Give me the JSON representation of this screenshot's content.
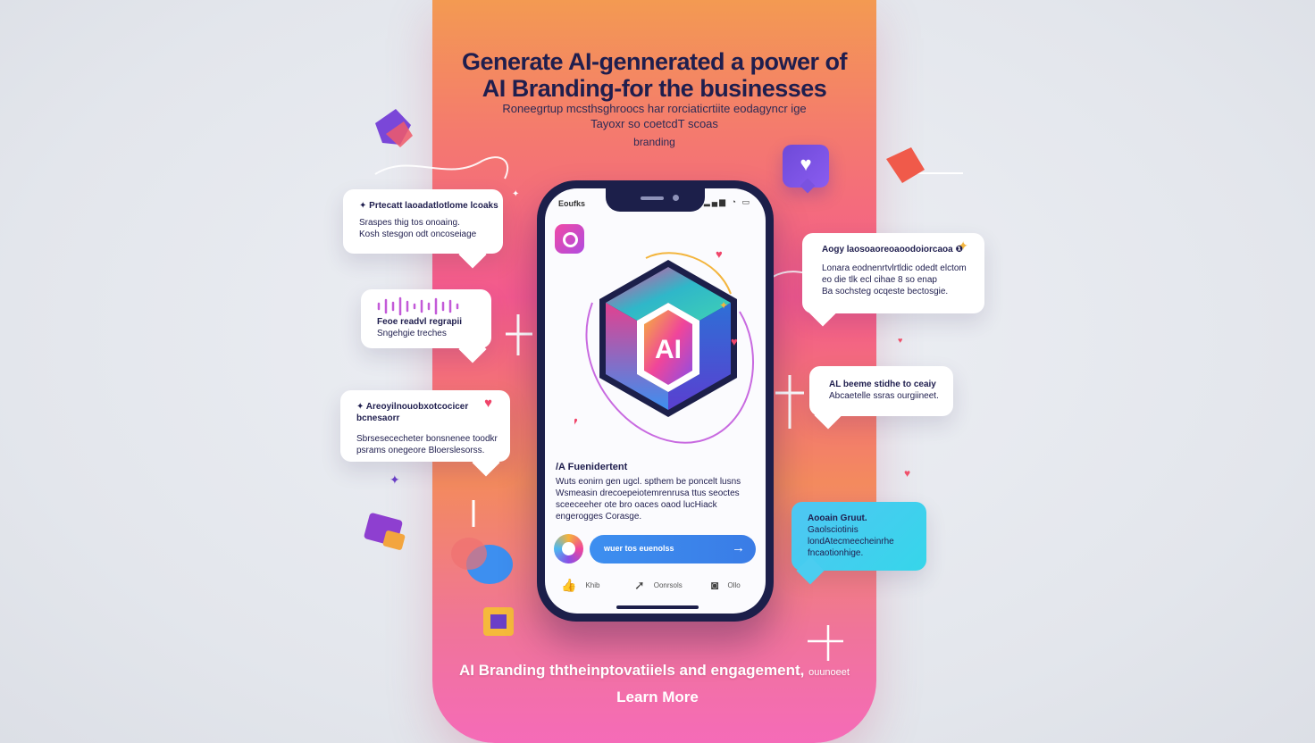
{
  "hero": {
    "headline_line1": "Generate AI-gennerated  a power of",
    "headline_line2": "AI  Branding-for the businesses",
    "sub_line1": "Roneegrtup mcsthsghroocs har rorciaticrtiite eodagyncr ige",
    "sub_line2": "Tayoxr so coetcdT scoas",
    "sub_line3": "branding"
  },
  "phone": {
    "status_label": "Eoufks",
    "status_icons": "▂▄▆ ◔ ▭",
    "logo_text": "AI",
    "section_title": "/A Fuenidertent",
    "section_body": "Wuts eonirn gen ugcl. spthem be poncelt lusns Wsmeasin drecoepeiotemrenrusa ttus seoctes sceeceeher ote bro oaces oaod lucHiack engerogges Corasge.",
    "cta_label": "wuer tos euenolss",
    "cta_arrow": "→",
    "actions": [
      {
        "icon": "thumbs-up",
        "glyph": "👍",
        "label": "Khib"
      },
      {
        "icon": "share",
        "glyph": "➚",
        "label": "Oonrsols"
      },
      {
        "icon": "save",
        "glyph": "◙",
        "label": "Ollo"
      }
    ]
  },
  "bubbles": {
    "left_top": {
      "line1": "✦ Prtecatt laoadatlotlome lcoaks",
      "line2": "Sraspes thig tos onoaing.",
      "line3": "Kosh stesgon odt oncoseiage"
    },
    "left_mid": {
      "line1": "Feoe readvl regrapii",
      "line2": "Sngehgie treches"
    },
    "left_bottom": {
      "line1": "✦ Areoyilnouobxotcocicer bcnesaorr",
      "line2": "Sbrsesececheter bonsnenee toodkr",
      "line3": "psrams onegeore Bloerslesorss."
    },
    "right_top": {
      "line1": "Aogy laosoaoreoaoodoiorcaoa ❶",
      "line2": "Lonara eodnenrtvlrtldic odedt elctom",
      "line3": "eo die tlk ecl cihae 8 so enap",
      "line4": "Ba sochsteg ocqeste bectosgie."
    },
    "right_mid": {
      "line1": "AL beeme stidhe to ceaiy",
      "line2": "Abcaetelle ssras ourgiineet."
    },
    "right_bottom": {
      "line1": "Aooain Gruut.",
      "line2": "Gaolsciotinis",
      "line3": "londAtecmeecheinrhe",
      "line4": "fncaotionhige."
    }
  },
  "footer": {
    "tagline": "AI Branding ththeinptovatiiels and engagement,",
    "tagline_small": "ouunoeet",
    "learn_more": "Learn More"
  },
  "colors": {
    "panel_top": "#f39a52",
    "panel_mid": "#f3598f",
    "navy": "#1c1f4a",
    "cta_blue": "#3d8ff0",
    "cyan_bubble": "#4fc6f3"
  }
}
